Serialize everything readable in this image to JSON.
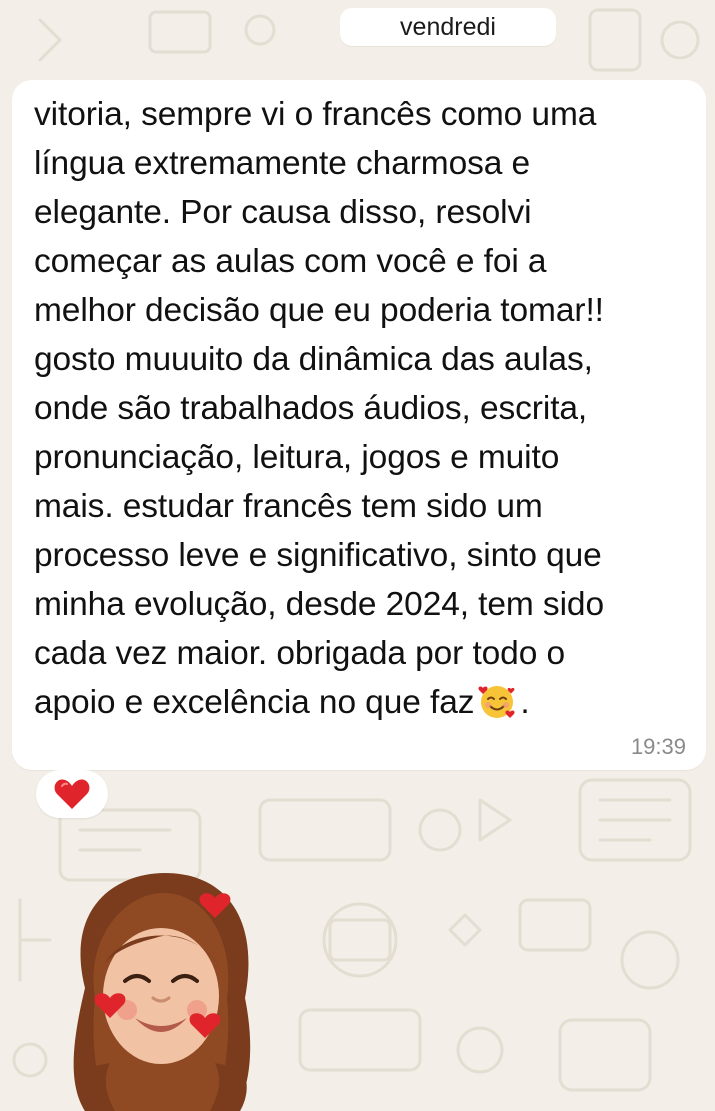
{
  "chat": {
    "date_separator": "vendredi",
    "message": {
      "lines": [
        "vitoria, sempre vi o francês como uma",
        "língua extremamente charmosa e",
        "elegante. Por causa disso, resolvi",
        "começar as aulas com você e foi a",
        "melhor decisão que eu poderia tomar!!",
        "gosto muuuito da dinâmica das aulas,",
        "onde são trabalhados áudios, escrita,",
        "pronunciação, leitura, jogos e muito",
        "mais. estudar francês tem sido um",
        "processo leve e significativo, sinto que",
        "minha evolução, desde 2024, tem sido",
        "cada vez maior. obrigada por todo o",
        "apoio e excelência no que faz"
      ],
      "trailing_emoji": "smiling-face-with-hearts",
      "trailing_punctuation": ".",
      "time": "19:39"
    },
    "reaction": {
      "emoji": "red-heart",
      "color": "#e0242c"
    },
    "sticker": {
      "description_icon": "memoji-sticker-with-hearts"
    }
  },
  "colors": {
    "wallpaper": "#f3efe8",
    "bubble": "#ffffff",
    "text": "#111111",
    "timestamp": "#8a8a8a",
    "heart": "#e0242c"
  }
}
